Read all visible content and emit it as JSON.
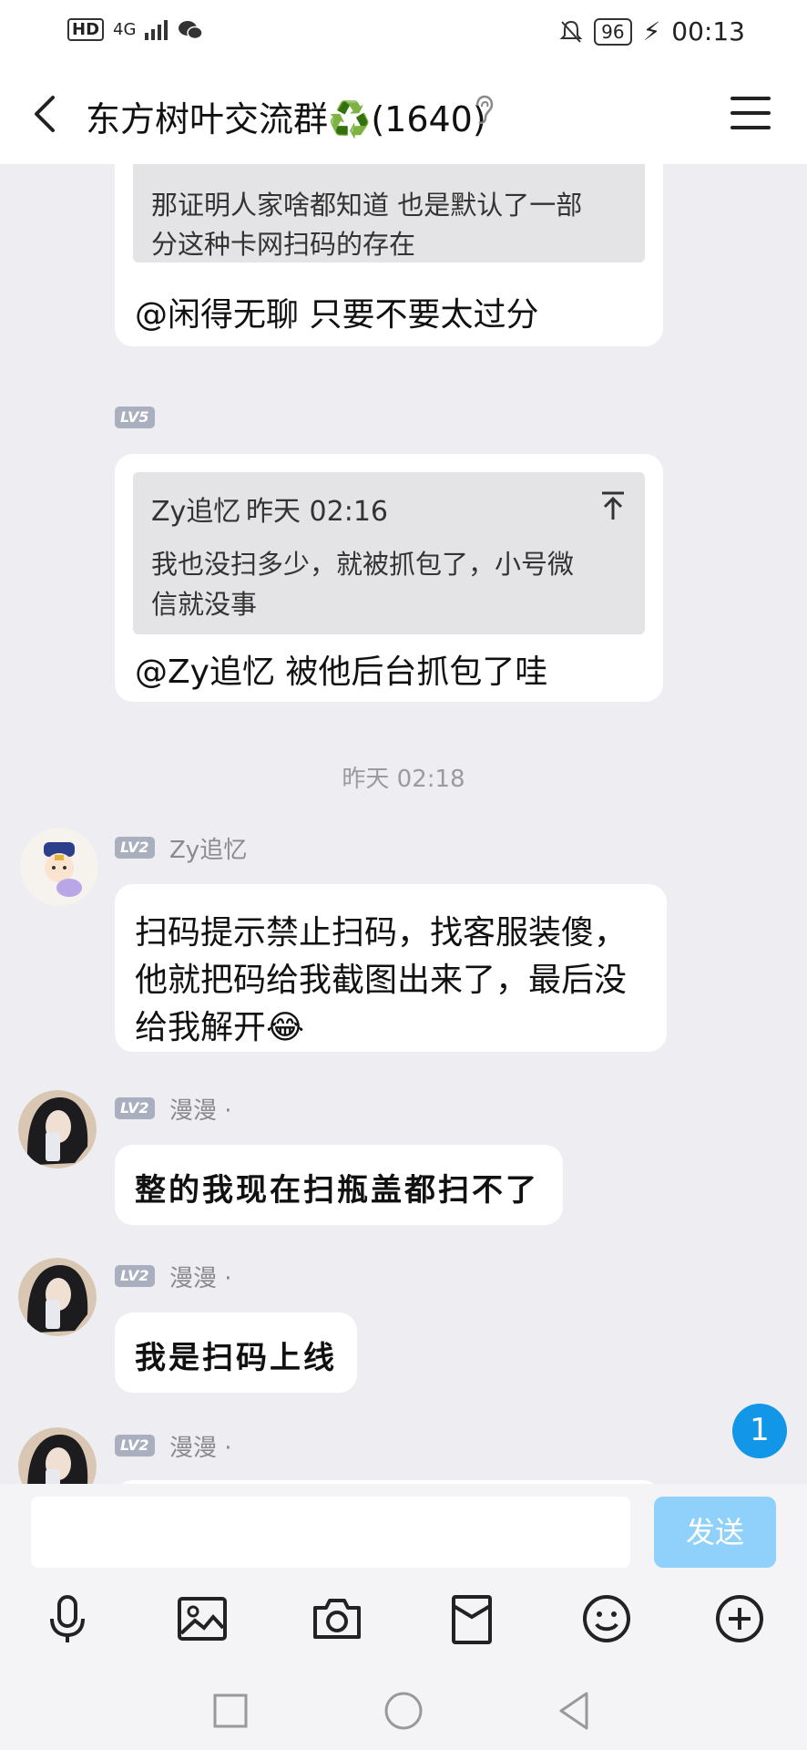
{
  "status_bar": {
    "network_left": "HD",
    "signal": "4G",
    "time": "00:13",
    "battery": "96"
  },
  "header": {
    "title": "东方树叶交流群♻️(1640)"
  },
  "messages": {
    "m1": {
      "quote_text_line1": "那证明人家啥都知道 也是默认了一部",
      "quote_text_line2": "分这种卡网扫码的存在",
      "text": "@闲得无聊 只要不要太过分"
    },
    "m2": {
      "level": "LV5",
      "quote_author": "Zy追忆",
      "quote_time": "昨天 02:16",
      "quote_text_line1": "我也没扫多少，就被抓包了，小号微",
      "quote_text_line2": "信就没事",
      "text": "@Zy追忆 被他后台抓包了哇"
    },
    "timestamp": "昨天 02:18",
    "m3": {
      "level": "LV2",
      "sender": "Zy追忆",
      "text_line1": "扫码提示禁止扫码，找客服装傻，",
      "text_line2": "他就把码给我截图出来了，最后没",
      "text_line3": "给我解开😂"
    },
    "m4": {
      "level": "LV2",
      "sender": "漫漫 ·",
      "text": "整的我现在扫瓶盖都扫不了"
    },
    "m5": {
      "level": "LV2",
      "sender": "漫漫 ·",
      "text": "我是扫码上线"
    },
    "m6": {
      "level": "LV2",
      "sender": "漫漫 ·"
    }
  },
  "unread_badge": "1",
  "input": {
    "placeholder": "",
    "send_label": "发送"
  },
  "colors": {
    "background": "#ededf2",
    "send_button": "#8fd1fb",
    "badge": "#1296e8"
  }
}
